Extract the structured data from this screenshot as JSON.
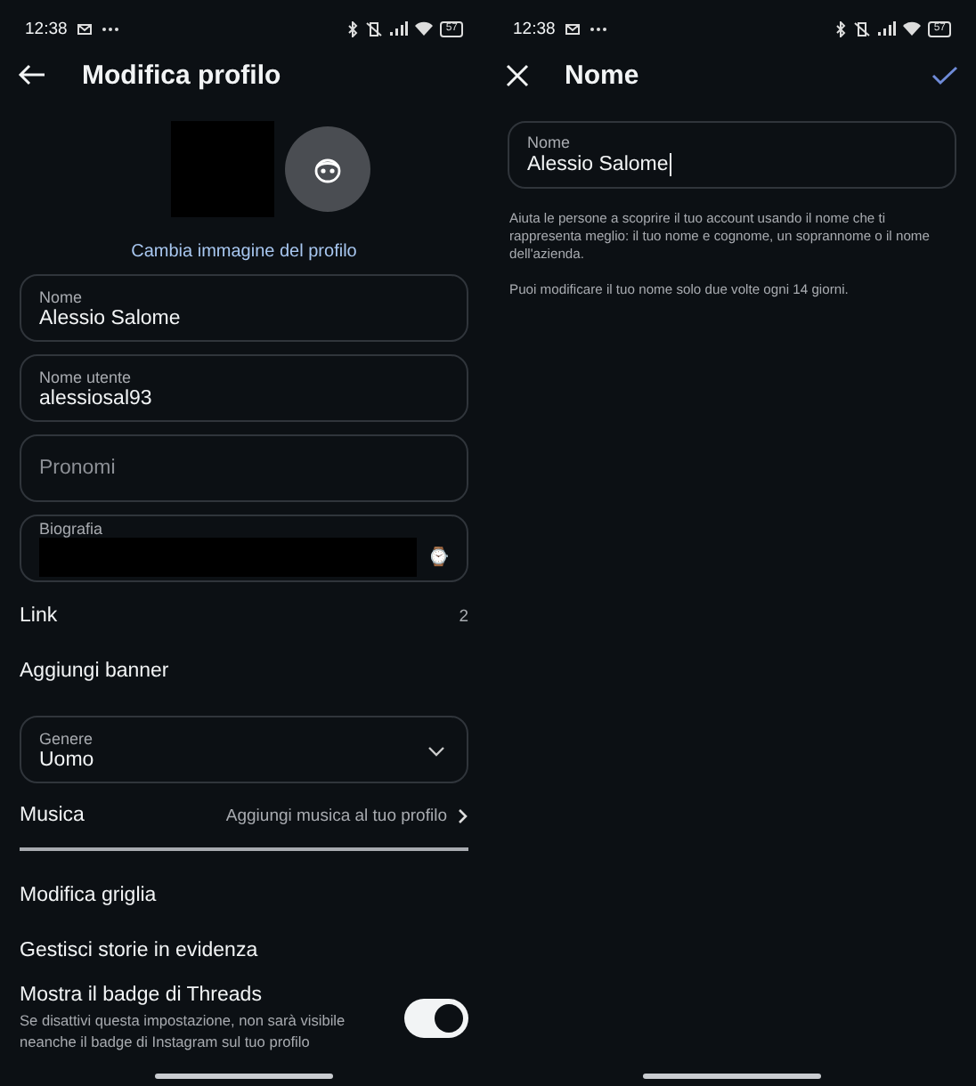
{
  "status_bars": [
    {
      "time": "12:38",
      "battery": "57"
    },
    {
      "time": "12:38",
      "battery": "57"
    }
  ],
  "edit_profile": {
    "title": "Modifica profilo",
    "change_photo": "Cambia immagine del profilo",
    "items": [
      {
        "kind": "field",
        "label": "Nome",
        "value": "Alessio Salome"
      },
      {
        "kind": "field",
        "label": "Nome utente",
        "value": "alessiosal93"
      },
      {
        "kind": "field",
        "placeholder": "Pronomi"
      },
      {
        "kind": "bio",
        "label": "Biografia",
        "emoji": "⌚"
      },
      {
        "kind": "row",
        "label": "Link",
        "value": "2"
      },
      {
        "kind": "row",
        "label": "Aggiungi banner"
      },
      {
        "kind": "select",
        "label": "Genere",
        "value": "Uomo"
      },
      {
        "kind": "nav",
        "label": "Musica",
        "value": "Aggiungi musica al tuo profilo"
      },
      {
        "kind": "row",
        "label": "Modifica griglia"
      },
      {
        "kind": "row",
        "label": "Gestisci storie in evidenza"
      },
      {
        "kind": "toggle",
        "label": "Mostra il badge di Threads",
        "description": "Se disattivi questa impostazione, non sarà visibile neanche il badge di Instagram sul tuo profilo",
        "on": true
      }
    ]
  },
  "name_editor": {
    "title": "Nome",
    "field": {
      "label": "Nome",
      "value": "Alessio Salome"
    },
    "help": [
      "Aiuta le persone a scoprire il tuo account usando il nome che ti rappresenta meglio: il tuo nome e cognome, un soprannome o il nome dell'azienda.",
      "Puoi modificare il tuo nome solo due volte ogni 14 giorni."
    ]
  }
}
